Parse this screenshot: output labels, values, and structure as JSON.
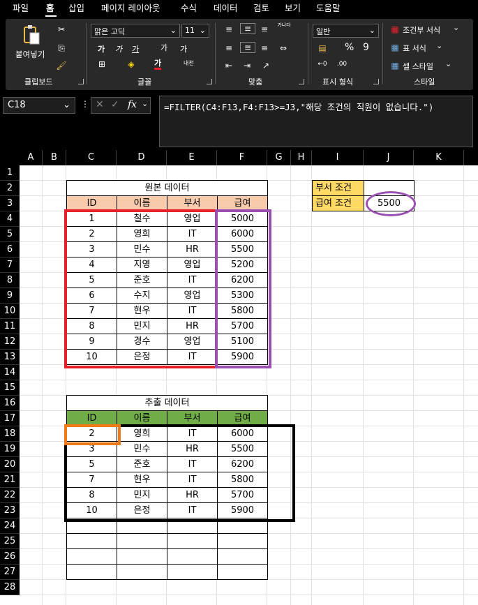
{
  "menu": [
    "파일",
    "홈",
    "삽입",
    "페이지 레이아웃",
    "수식",
    "데이터",
    "검토",
    "보기",
    "도움말"
  ],
  "ribbon": {
    "clipboard": {
      "paste_label": "붙여넣기",
      "group_label": "클립보드"
    },
    "font": {
      "font_name": "맑은 고딕",
      "font_size": "11",
      "group_label": "글꼴",
      "bold": "가",
      "italic": "가",
      "underline": "가",
      "grow": "가",
      "shrink": "가",
      "color_a": "가",
      "phonetic": "내천"
    },
    "alignment": {
      "group_label": "맞춤",
      "wrap": "가나다"
    },
    "number": {
      "format": "일반",
      "group_label": "표시 형식",
      "percent": "%",
      "comma": "9"
    },
    "styles": {
      "conditional": "조건부 서식",
      "table": "표 서식",
      "cell": "셀 스타일",
      "group_label": "스타일"
    }
  },
  "formula_bar": {
    "name_box": "C18",
    "fx": "fx",
    "formula": "=FILTER(C4:F13,F4:F13>=J3,\"해당 조건의 직원이 없습니다.\")"
  },
  "columns": [
    "A",
    "B",
    "C",
    "D",
    "E",
    "F",
    "G",
    "H",
    "I",
    "J",
    "K"
  ],
  "rows": [
    "1",
    "2",
    "3",
    "4",
    "5",
    "6",
    "7",
    "8",
    "9",
    "10",
    "11",
    "12",
    "13",
    "14",
    "15",
    "16",
    "17",
    "18",
    "19",
    "20",
    "21",
    "22",
    "23",
    "24",
    "25",
    "26",
    "27",
    "28"
  ],
  "source_table": {
    "title": "원본 데이터",
    "headers": [
      "ID",
      "이름",
      "부서",
      "급여"
    ],
    "rows": [
      [
        "1",
        "철수",
        "영업",
        "5000"
      ],
      [
        "2",
        "영희",
        "IT",
        "6000"
      ],
      [
        "3",
        "민수",
        "HR",
        "5500"
      ],
      [
        "4",
        "지영",
        "영업",
        "5200"
      ],
      [
        "5",
        "준호",
        "IT",
        "6200"
      ],
      [
        "6",
        "수지",
        "영업",
        "5300"
      ],
      [
        "7",
        "현우",
        "IT",
        "5800"
      ],
      [
        "8",
        "민지",
        "HR",
        "5700"
      ],
      [
        "9",
        "경수",
        "영업",
        "5100"
      ],
      [
        "10",
        "은정",
        "IT",
        "5900"
      ]
    ]
  },
  "conditions": {
    "dept_label": "부서 조건",
    "dept_value": "",
    "salary_label": "급여 조건",
    "salary_value": "5500"
  },
  "result_table": {
    "title": "추출 데이터",
    "headers": [
      "ID",
      "이름",
      "부서",
      "급여"
    ],
    "rows": [
      [
        "2",
        "영희",
        "IT",
        "6000"
      ],
      [
        "3",
        "민수",
        "HR",
        "5500"
      ],
      [
        "5",
        "준호",
        "IT",
        "6200"
      ],
      [
        "7",
        "현우",
        "IT",
        "5800"
      ],
      [
        "8",
        "민지",
        "HR",
        "5700"
      ],
      [
        "10",
        "은정",
        "IT",
        "5900"
      ],
      [
        "",
        "",
        "",
        ""
      ],
      [
        "",
        "",
        "",
        ""
      ],
      [
        "",
        "",
        "",
        ""
      ],
      [
        "",
        "",
        "",
        ""
      ]
    ]
  },
  "colors": {
    "source_header": "#f8cbad",
    "result_header": "#70ad47",
    "condition_label": "#ffd966",
    "highlight_red": "#e8202a",
    "highlight_purple": "#9b4fb0",
    "highlight_orange": "#f07a1a",
    "highlight_black": "#000000"
  }
}
